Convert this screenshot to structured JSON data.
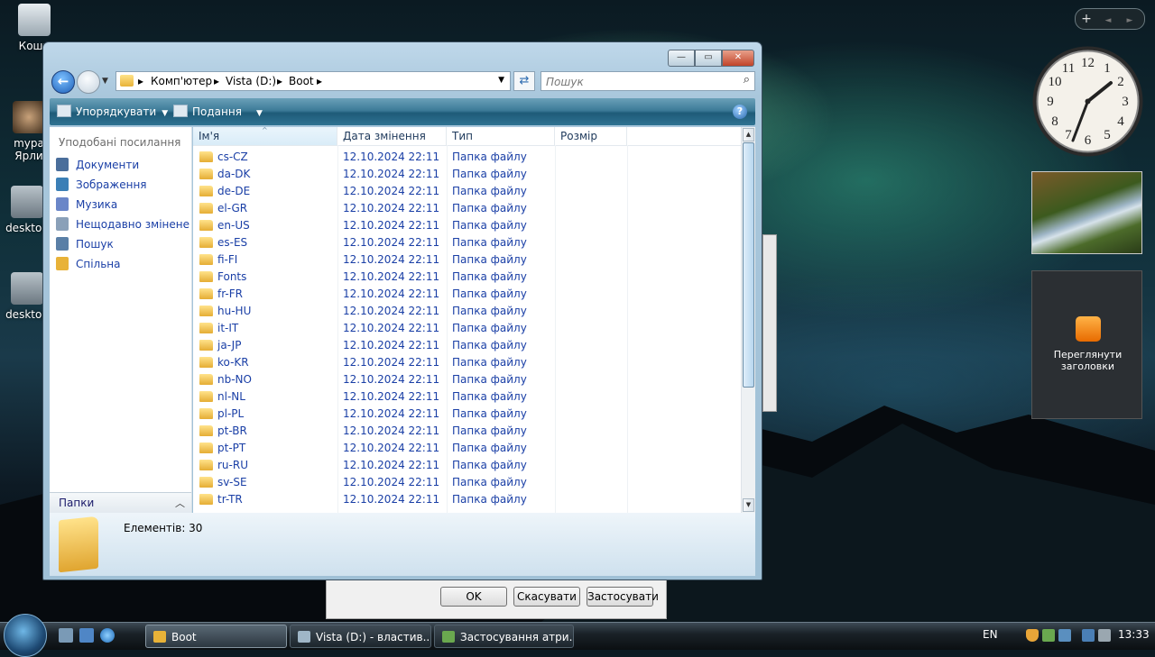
{
  "desktop": {
    "icons": [
      {
        "label": "Коши"
      },
      {
        "label": "mypa\nЯрли"
      },
      {
        "label": "desktop"
      },
      {
        "label": "desktop"
      }
    ]
  },
  "gadgets": {
    "clock": {
      "time": "13:33"
    },
    "feed_label": "Переглянути заголовки",
    "controls": {
      "add": "+",
      "prev": "◄",
      "next": "►"
    }
  },
  "window": {
    "controls": {
      "minimize": "—",
      "maximize": "▭",
      "close": "✕"
    },
    "address": {
      "crumbs": [
        "Комп'ютер",
        "Vista (D:)",
        "Boot"
      ]
    },
    "search": {
      "placeholder": "Пошук"
    },
    "toolbar": {
      "organize_label": "Упорядкувати",
      "views_label": "Подання"
    },
    "nav": {
      "title": "Уподобані посилання",
      "items": [
        {
          "label": "Документи",
          "color": "#4a6e9b"
        },
        {
          "label": "Зображення",
          "color": "#3b7fb6"
        },
        {
          "label": "Музика",
          "color": "#6a86c8"
        },
        {
          "label": "Нещодавно змінене",
          "color": "#8aa0b8"
        },
        {
          "label": "Пошук",
          "color": "#5a7fa6"
        },
        {
          "label": "Спільна",
          "color": "#e8b238"
        }
      ],
      "folders_label": "Папки"
    },
    "columns": {
      "name": "Ім'я",
      "date": "Дата змінення",
      "type": "Тип",
      "size": "Розмір"
    },
    "files": [
      {
        "name": "cs-CZ",
        "date": "12.10.2024 22:11",
        "type": "Папка файлу"
      },
      {
        "name": "da-DK",
        "date": "12.10.2024 22:11",
        "type": "Папка файлу"
      },
      {
        "name": "de-DE",
        "date": "12.10.2024 22:11",
        "type": "Папка файлу"
      },
      {
        "name": "el-GR",
        "date": "12.10.2024 22:11",
        "type": "Папка файлу"
      },
      {
        "name": "en-US",
        "date": "12.10.2024 22:11",
        "type": "Папка файлу"
      },
      {
        "name": "es-ES",
        "date": "12.10.2024 22:11",
        "type": "Папка файлу"
      },
      {
        "name": "fi-FI",
        "date": "12.10.2024 22:11",
        "type": "Папка файлу"
      },
      {
        "name": "Fonts",
        "date": "12.10.2024 22:11",
        "type": "Папка файлу"
      },
      {
        "name": "fr-FR",
        "date": "12.10.2024 22:11",
        "type": "Папка файлу"
      },
      {
        "name": "hu-HU",
        "date": "12.10.2024 22:11",
        "type": "Папка файлу"
      },
      {
        "name": "it-IT",
        "date": "12.10.2024 22:11",
        "type": "Папка файлу"
      },
      {
        "name": "ja-JP",
        "date": "12.10.2024 22:11",
        "type": "Папка файлу"
      },
      {
        "name": "ko-KR",
        "date": "12.10.2024 22:11",
        "type": "Папка файлу"
      },
      {
        "name": "nb-NO",
        "date": "12.10.2024 22:11",
        "type": "Папка файлу"
      },
      {
        "name": "nl-NL",
        "date": "12.10.2024 22:11",
        "type": "Папка файлу"
      },
      {
        "name": "pl-PL",
        "date": "12.10.2024 22:11",
        "type": "Папка файлу"
      },
      {
        "name": "pt-BR",
        "date": "12.10.2024 22:11",
        "type": "Папка файлу"
      },
      {
        "name": "pt-PT",
        "date": "12.10.2024 22:11",
        "type": "Папка файлу"
      },
      {
        "name": "ru-RU",
        "date": "12.10.2024 22:11",
        "type": "Папка файлу"
      },
      {
        "name": "sv-SE",
        "date": "12.10.2024 22:11",
        "type": "Папка файлу"
      },
      {
        "name": "tr-TR",
        "date": "12.10.2024 22:11",
        "type": "Папка файлу"
      }
    ],
    "details": {
      "count_label": "Елементів: 30"
    }
  },
  "properties_dialog": {
    "ok": "OK",
    "cancel": "Скасувати",
    "apply": "Застосувати"
  },
  "taskbar": {
    "tasks": [
      {
        "label": "Boot",
        "active": true,
        "color": "#e8b238"
      },
      {
        "label": "Vista (D:) - властив...",
        "active": false,
        "color": "#9fb6c7"
      },
      {
        "label": "Застосування атри...",
        "active": false,
        "color": "#6aa84f"
      }
    ],
    "lang": "EN",
    "time": "13:33"
  },
  "colors": {
    "link": "#1a3fa6",
    "accent": "#2b6ab0"
  }
}
